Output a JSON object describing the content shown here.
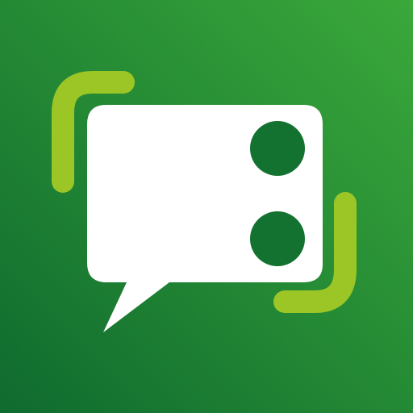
{
  "app_icon": {
    "symbol": "chat-bubble-icon",
    "colors": {
      "background_start": "#0f6b2f",
      "background_end": "#3aa83a",
      "bracket": "#9cc526",
      "bubble": "#ffffff",
      "dots": "#13722f"
    }
  }
}
